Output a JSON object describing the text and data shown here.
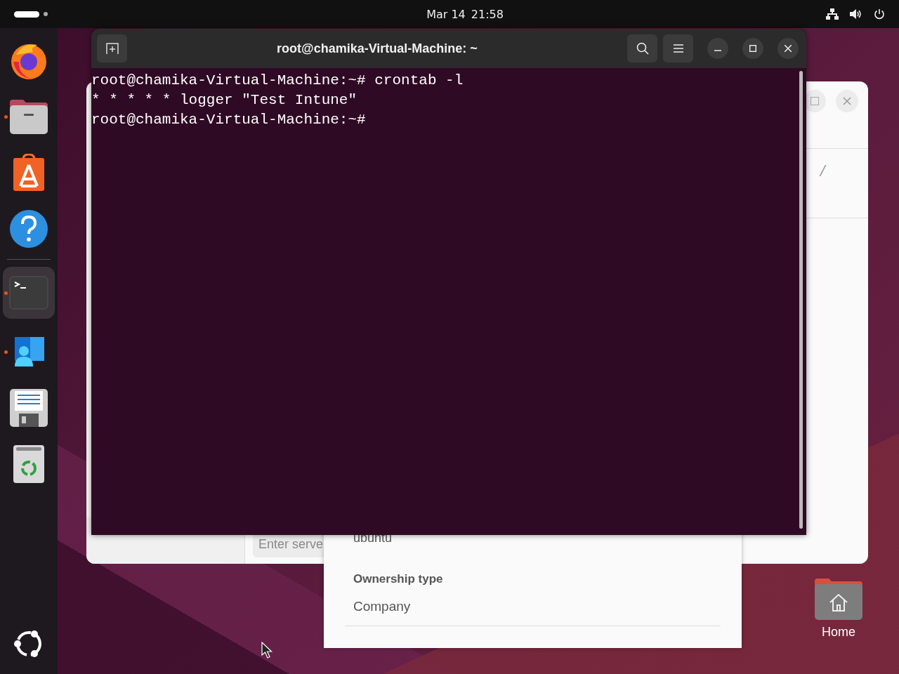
{
  "top_bar": {
    "date": "Mar 14",
    "time": "21:58"
  },
  "dock": {
    "items": [
      {
        "kind": "firefox",
        "running": false,
        "selected": false
      },
      {
        "kind": "files",
        "running": true,
        "selected": false
      },
      {
        "kind": "store",
        "running": false,
        "selected": false
      },
      {
        "kind": "help",
        "running": false,
        "selected": false
      },
      {
        "kind": "terminal",
        "running": true,
        "selected": true
      },
      {
        "kind": "portal",
        "running": true,
        "selected": false
      },
      {
        "kind": "editor",
        "running": false,
        "selected": false
      },
      {
        "kind": "trash",
        "running": false,
        "selected": false
      }
    ]
  },
  "files_window": {
    "server_placeholder": "Enter serve",
    "path": "/"
  },
  "dialog": {
    "value": "ubuntu",
    "field_label": "Ownership type",
    "field_value": "Company"
  },
  "terminal": {
    "title": "root@chamika-Virtual-Machine: ~",
    "lines": [
      "root@chamika-Virtual-Machine:~# crontab -l",
      "* * * * * logger \"Test Intune\"",
      "root@chamika-Virtual-Machine:~#"
    ]
  },
  "desktop_icons": [
    {
      "label": "Home"
    }
  ]
}
